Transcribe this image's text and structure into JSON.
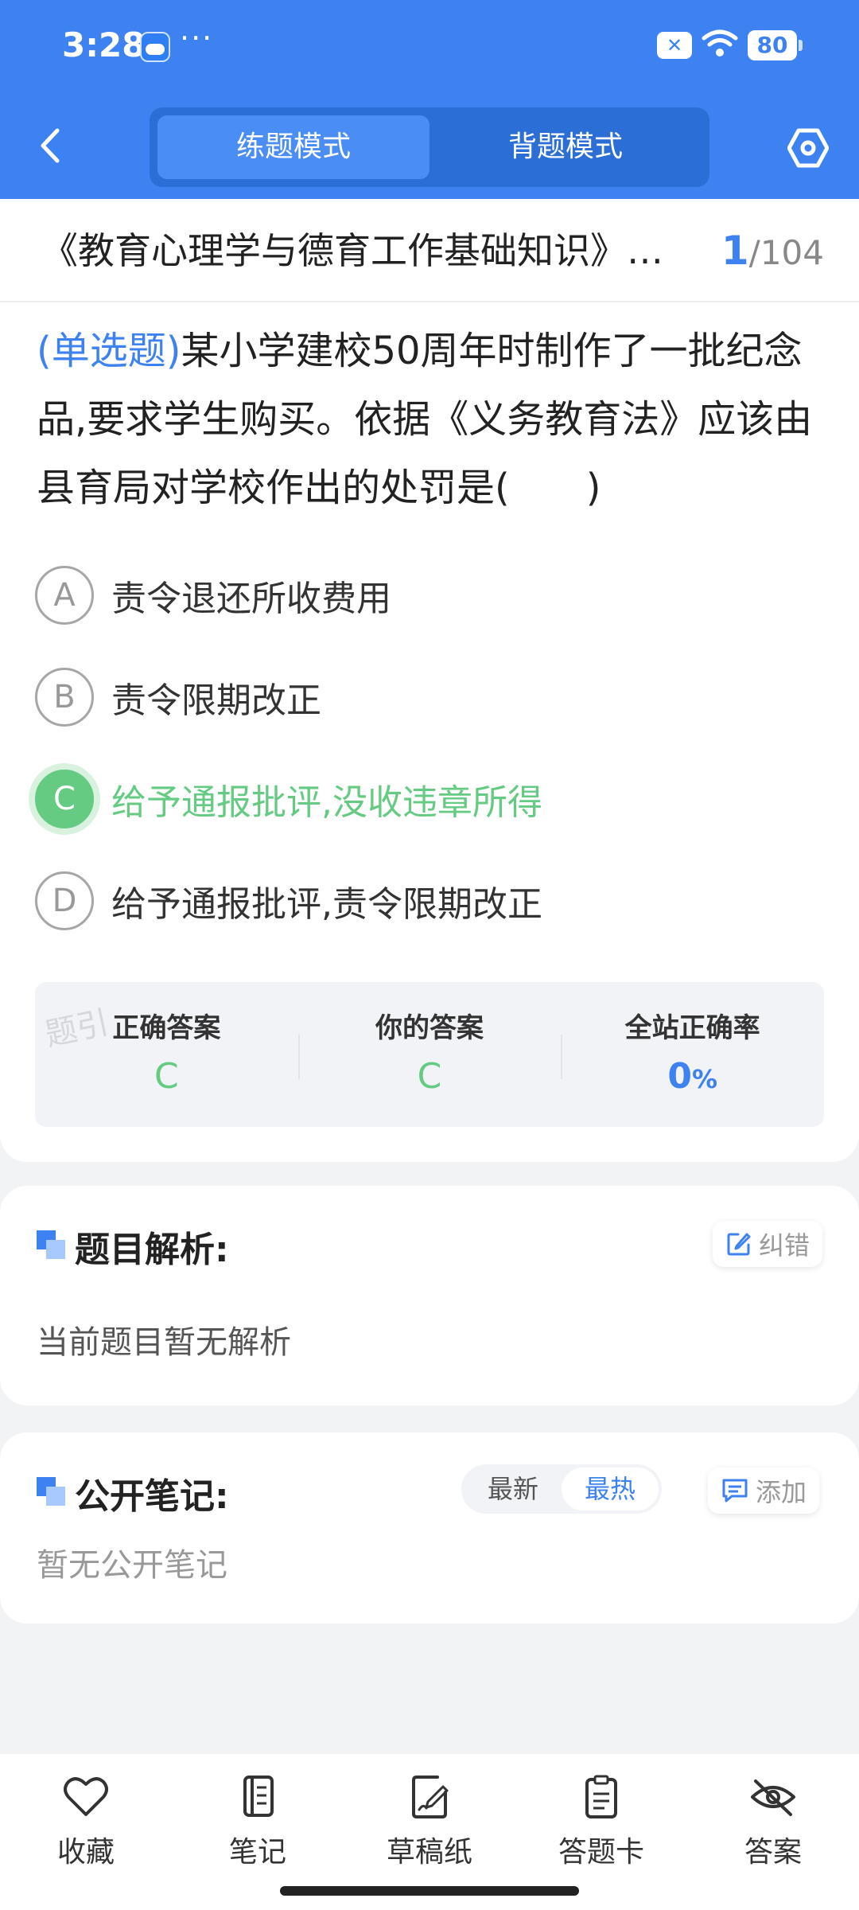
{
  "status_bar": {
    "time": "3:28",
    "more": "···",
    "battery": "80"
  },
  "header": {
    "tabs": [
      {
        "label": "练题模式",
        "active": true
      },
      {
        "label": "背题模式",
        "active": false
      }
    ],
    "icons": [
      "back-icon",
      "settings-icon"
    ]
  },
  "exam": {
    "title": "《教育心理学与德育工作基础知识》试题",
    "current": "1",
    "separator": "/",
    "total": "104"
  },
  "question": {
    "type": "(单选题)",
    "text": "某小学建校50周年时制作了一批纪念品,要求学生购买。依据《义务教育法》应该由县育局对学校作出的处罚是(　　)",
    "options": [
      {
        "letter": "A",
        "text": "责令退还所收费用",
        "state": "normal"
      },
      {
        "letter": "B",
        "text": "责令限期改正",
        "state": "normal"
      },
      {
        "letter": "C",
        "text": "给予通报批评,没收违章所得",
        "state": "correct"
      },
      {
        "letter": "D",
        "text": "给予通报批评,责令限期改正",
        "state": "normal"
      }
    ]
  },
  "result": {
    "watermark": "题引",
    "correct_label": "正确答案",
    "correct_value": "C",
    "yours_label": "你的答案",
    "yours_value": "C",
    "rate_label": "全站正确率",
    "rate_value": "0",
    "rate_unit": "%"
  },
  "analysis": {
    "title": "题目解析:",
    "report_label": "纠错",
    "content": "当前题目暂无解析"
  },
  "notes": {
    "title": "公开笔记:",
    "sort_tabs": [
      {
        "label": "最新",
        "active": false
      },
      {
        "label": "最热",
        "active": true
      }
    ],
    "add_label": "添加",
    "empty": "暂无公开笔记"
  },
  "bottom_nav": [
    {
      "label": "收藏",
      "icon": "heart-icon"
    },
    {
      "label": "笔记",
      "icon": "notebook-icon"
    },
    {
      "label": "草稿纸",
      "icon": "draft-icon"
    },
    {
      "label": "答题卡",
      "icon": "answer-card-icon"
    },
    {
      "label": "答案",
      "icon": "eye-off-icon"
    }
  ],
  "colors": {
    "primary": "#3d82f0",
    "correct": "#65ca82",
    "background": "#f2f3f5"
  }
}
